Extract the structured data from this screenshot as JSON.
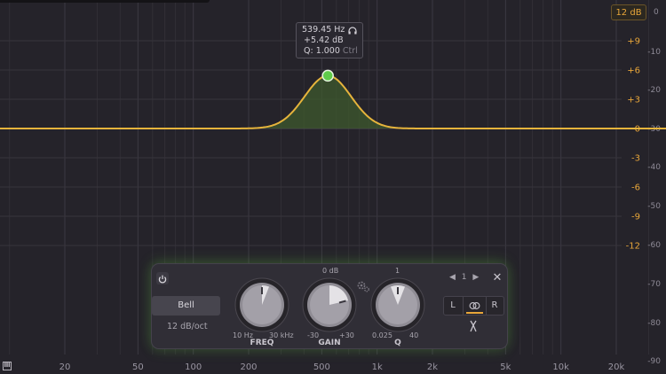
{
  "range_button": "12 dB",
  "top_right_zero": "0",
  "gain_axis": [
    {
      "label": "+9",
      "db": 9
    },
    {
      "label": "+6",
      "db": 6
    },
    {
      "label": "+3",
      "db": 3
    },
    {
      "label": "0",
      "db": 0
    },
    {
      "label": "-3",
      "db": -3
    },
    {
      "label": "-6",
      "db": -6
    },
    {
      "label": "-9",
      "db": -9
    },
    {
      "label": "-12",
      "db": -12
    }
  ],
  "spectrum_axis": [
    "-10",
    "-20",
    "-30",
    "-40",
    "-50",
    "-60",
    "-70",
    "-80",
    "-90"
  ],
  "freq_axis": [
    {
      "label": "20",
      "hz": 20
    },
    {
      "label": "50",
      "hz": 50
    },
    {
      "label": "100",
      "hz": 100
    },
    {
      "label": "200",
      "hz": 200
    },
    {
      "label": "500",
      "hz": 500
    },
    {
      "label": "1k",
      "hz": 1000
    },
    {
      "label": "2k",
      "hz": 2000
    },
    {
      "label": "5k",
      "hz": 5000
    },
    {
      "label": "10k",
      "hz": 10000
    },
    {
      "label": "20k",
      "hz": 20000
    }
  ],
  "band": {
    "freq_hz": 539.45,
    "gain_db": 5.42,
    "q": 1.0
  },
  "tooltip": {
    "freq": "539.45 Hz",
    "gain": "+5.42 dB",
    "q": "Q: 1.000",
    "ctrl": "Ctrl"
  },
  "panel": {
    "filter_type": "Bell",
    "slope": "12 dB/oct",
    "band_number": "1",
    "freq_knob": {
      "name": "FREQ",
      "min": "10 Hz",
      "max": "30 kHz"
    },
    "gain_knob": {
      "name": "GAIN",
      "min": "-30",
      "max": "+30",
      "top": "0 dB"
    },
    "q_knob": {
      "name": "Q",
      "min": "0.025",
      "max": "40",
      "top": "1"
    },
    "stereo": {
      "left": "L",
      "right": "R"
    }
  },
  "colors": {
    "curve": "#e6b43c",
    "fill": "#3d5a2e",
    "node": "#5fcb4a",
    "gain_label": "#e8a63a",
    "accent_glow": "#5aaa3c"
  },
  "icons": {
    "power": "power-icon",
    "headphones": "headphones-icon",
    "close": "close-icon",
    "gear": "gear-icon",
    "split": "split-icon",
    "piano": "piano-icon",
    "stereo_link": "stereo-link-icon"
  }
}
